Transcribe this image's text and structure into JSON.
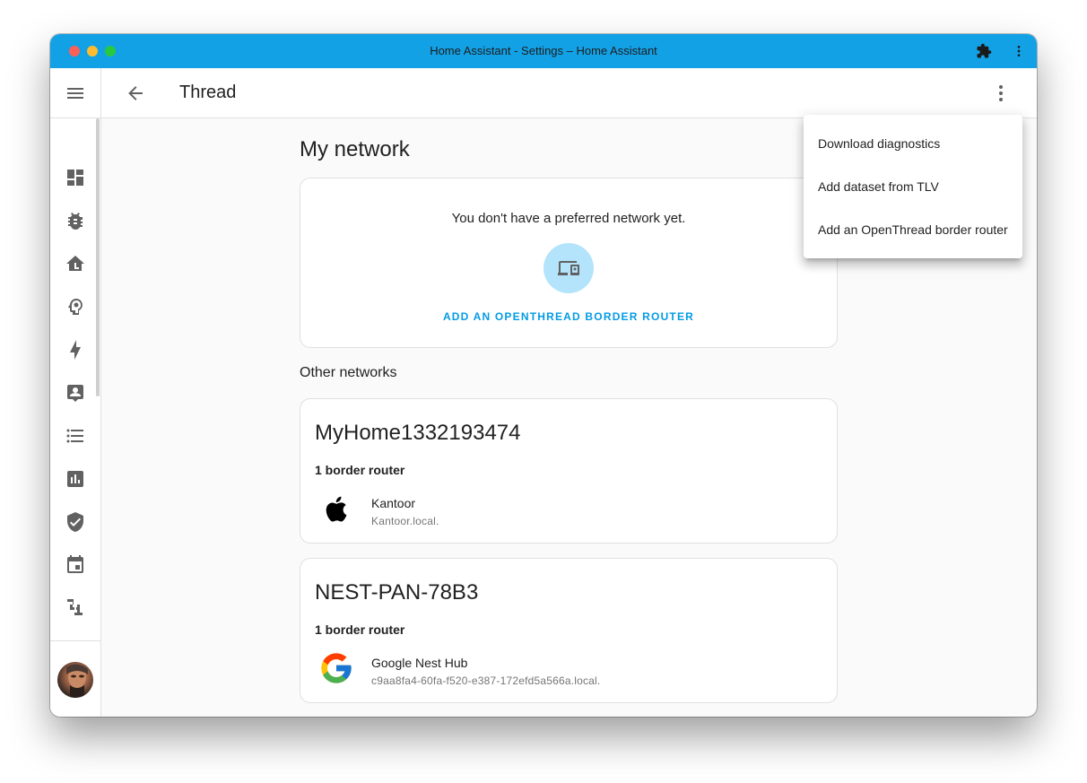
{
  "window": {
    "title": "Home Assistant - Settings – Home Assistant"
  },
  "titlebar": {
    "extension_icon": "puzzle-icon",
    "more_icon": "dots-vertical-icon"
  },
  "appbar": {
    "title": "Thread",
    "back_icon": "arrow-left-icon",
    "more_icon": "dots-vertical-icon"
  },
  "sidebar": {
    "menu_icon": "menu-icon",
    "items": [
      {
        "name": "overview",
        "icon": "view-dashboard-icon"
      },
      {
        "name": "bug",
        "icon": "bug-icon"
      },
      {
        "name": "home-floor",
        "icon": "home-floor-icon"
      },
      {
        "name": "head-cog",
        "icon": "head-cog-icon"
      },
      {
        "name": "energy",
        "icon": "lightning-bolt-icon"
      },
      {
        "name": "account-box",
        "icon": "account-box-icon"
      },
      {
        "name": "list",
        "icon": "format-list-bulleted-icon"
      },
      {
        "name": "history",
        "icon": "chart-box-icon"
      },
      {
        "name": "security",
        "icon": "shield-check-icon"
      },
      {
        "name": "calendar",
        "icon": "calendar-icon"
      },
      {
        "name": "tools",
        "icon": "hammer-icon"
      }
    ],
    "notifications_icon": "bell-icon",
    "avatar": "user-avatar"
  },
  "main": {
    "my_network_heading": "My network",
    "no_preferred": "You don't have a preferred network yet.",
    "router_icon": "devices-icon",
    "add_router_button": "ADD AN OPENTHREAD BORDER ROUTER",
    "other_networks_heading": "Other networks",
    "networks": [
      {
        "name": "MyHome1332193474",
        "router_count": "1 border router",
        "router": {
          "name": "Kantoor",
          "host": "Kantoor.local.",
          "logo": "apple-logo"
        }
      },
      {
        "name": "NEST-PAN-78B3",
        "router_count": "1 border router",
        "router": {
          "name": "Google Nest Hub",
          "host": "c9aa8fa4-60fa-f520-e387-172efd5a566a.local.",
          "logo": "google-logo"
        }
      }
    ]
  },
  "menu": {
    "items": [
      "Download diagnostics",
      "Add dataset from TLV",
      "Add an OpenThread border router"
    ]
  },
  "colors": {
    "titlebar": "#13a1e6",
    "accent": "#039be5",
    "icon": "#616161"
  }
}
